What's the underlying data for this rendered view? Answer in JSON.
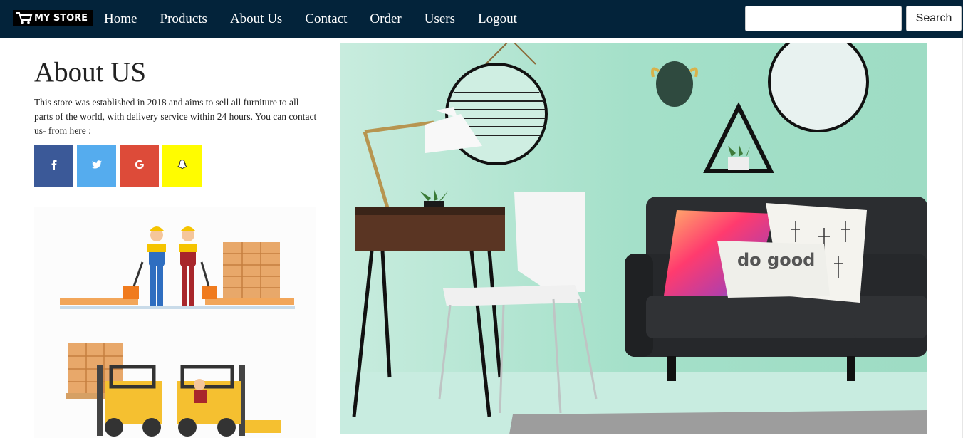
{
  "navbar": {
    "brand": "MY STORE",
    "links": [
      "Home",
      "Products",
      "About Us",
      "Contact",
      "Order",
      "Users",
      "Logout"
    ],
    "search_placeholder": "",
    "search_value": "",
    "search_button": "Search"
  },
  "about": {
    "title": "About US",
    "text": "This store was established in 2018 and aims to sell all furniture to all parts of the world, with delivery service within 24 hours. You can contact us- from here :"
  },
  "socials": [
    {
      "name": "facebook",
      "glyph": "f",
      "color": "#3b5998"
    },
    {
      "name": "twitter",
      "glyph": "🐦",
      "color": "#55acee"
    },
    {
      "name": "google",
      "glyph": "G",
      "color": "#dd4b39"
    },
    {
      "name": "snapchat",
      "glyph": "👻",
      "color": "#fffc00"
    }
  ],
  "pillow_text": "do good",
  "colors": {
    "navbar": "#03233a",
    "wall": "#9edcc4"
  }
}
